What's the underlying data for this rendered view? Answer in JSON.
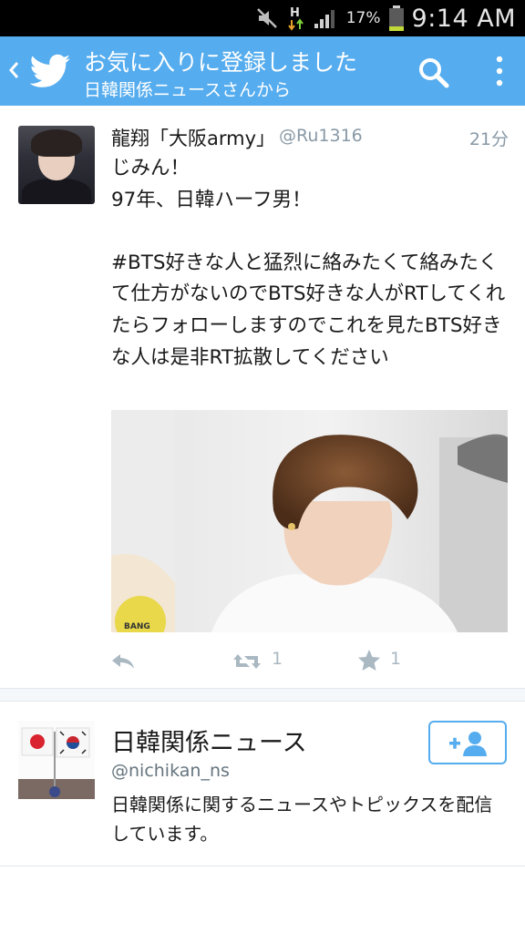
{
  "status_bar": {
    "battery_percent": "17%",
    "time": "9:14 AM",
    "icons": [
      "mute-icon",
      "h-plus-data-icon",
      "signal-icon",
      "battery-icon"
    ]
  },
  "app_bar": {
    "title": "お気に入りに登録しました",
    "subtitle": "日韓関係ニュースさんから",
    "background_color": "#55acee",
    "icons": [
      "back-chevron-icon",
      "twitter-bird-icon",
      "search-icon",
      "overflow-menu-icon"
    ]
  },
  "tweet": {
    "author_name": "龍翔「大阪army」",
    "author_handle": "@Ru1316",
    "time": "21分",
    "text": "じみん！\n97年、日韓ハーフ男！\n\n#BTS好きな人と猛烈に絡みたくて絡みたくて仕方がないのでBTS好きな人がRTしてくれたらフォローしますのでこれを見たBTS好きな人は是非RT拡散してください",
    "photo_caption": "BANG",
    "actions": {
      "retweet_count": "1",
      "favorite_count": "1"
    }
  },
  "user_card": {
    "name": "日韓関係ニュース",
    "handle": "@nichikan_ns",
    "bio": "日韓関係に関するニュースやトピックスを配信しています。"
  }
}
